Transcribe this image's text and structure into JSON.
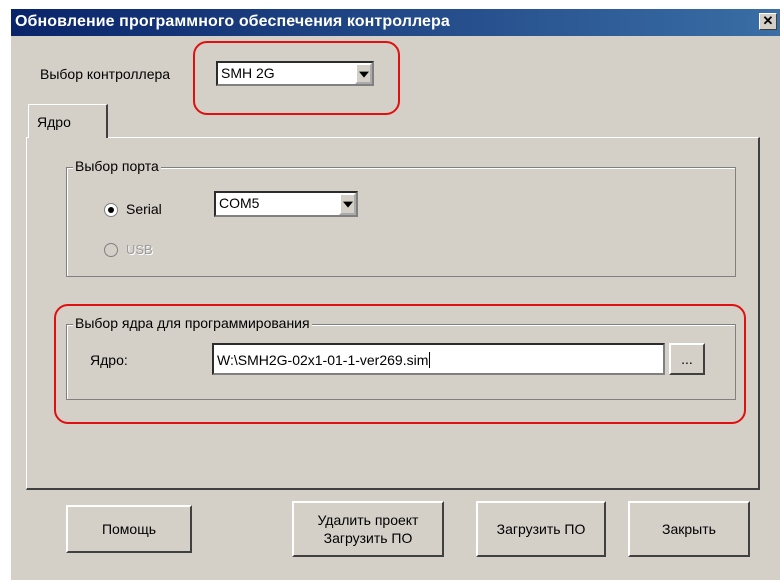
{
  "window": {
    "title": "Обновление программного обеспечения контроллера"
  },
  "controller": {
    "label": "Выбор контроллера",
    "selected": "SMH 2G"
  },
  "tabs": [
    {
      "label": "Ядро"
    }
  ],
  "port_group": {
    "title": "Выбор порта",
    "serial_label": "Serial",
    "serial_checked": true,
    "usb_label": "USB",
    "usb_enabled": false,
    "com_selected": "COM5"
  },
  "core_group": {
    "title": "Выбор ядра для программирования",
    "core_label": "Ядро:",
    "core_value": "W:\\SMH2G-02x1-01-1-ver269.sim",
    "browse_label": "..."
  },
  "buttons": {
    "help": "Помощь",
    "delete_project_line1": "Удалить проект",
    "delete_project_line2": "Загрузить ПО",
    "upload": "Загрузить ПО",
    "close": "Закрыть"
  },
  "colors": {
    "highlight_outline": "#e01010",
    "titlebar_start": "#0a246a",
    "titlebar_end": "#3a6ea5"
  }
}
